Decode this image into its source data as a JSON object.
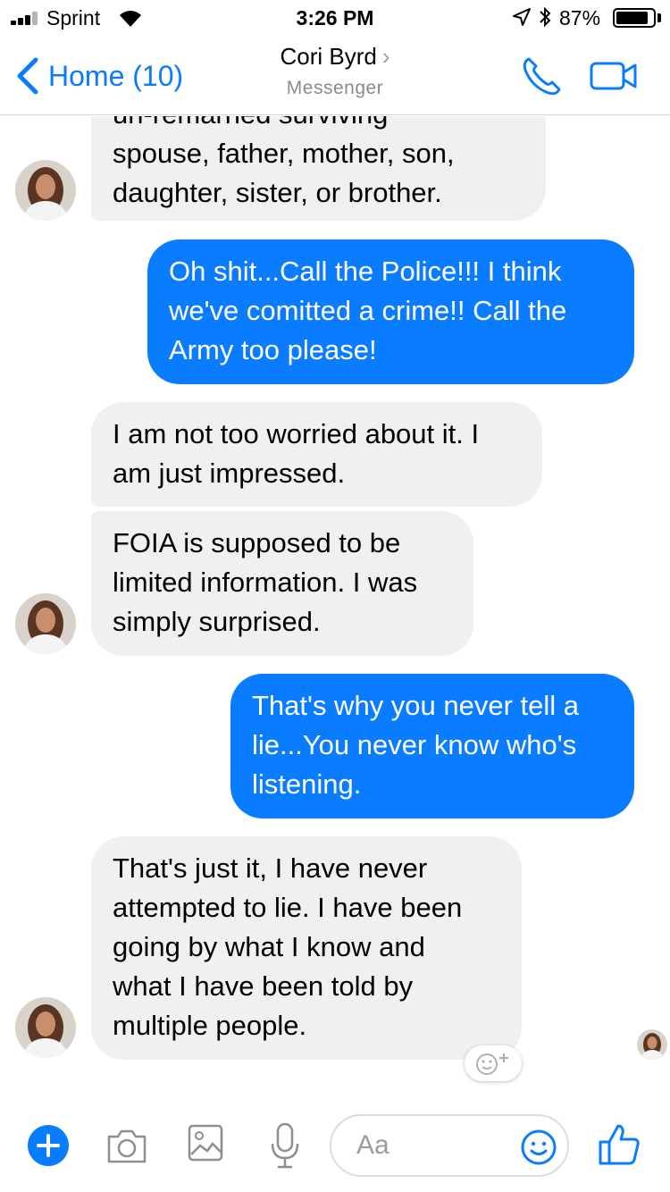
{
  "status_bar": {
    "carrier": "Sprint",
    "time": "3:26 PM",
    "battery_percent": "87%",
    "battery_level": 0.87,
    "signal_bars_filled": 3
  },
  "header": {
    "back_label": "Home (10)",
    "contact_name": "Cori Byrd",
    "subtitle": "Messenger",
    "call_icon": "phone-icon",
    "video_icon": "video-camera-icon"
  },
  "messages": [
    {
      "direction": "in",
      "lines": [
        "un-remarried surviving",
        "spouse, father, mother, son,",
        "daughter, sister, or brother."
      ]
    },
    {
      "direction": "out",
      "lines": [
        "Oh shit...Call the Police!!! I think",
        "we've comitted a crime!! Call the",
        "Army too please!"
      ]
    },
    {
      "direction": "in",
      "lines": [
        "I am not too worried about it. I",
        "am just impressed."
      ]
    },
    {
      "direction": "in",
      "lines": [
        "FOIA is supposed to be",
        "limited information. I was",
        "simply surprised."
      ]
    },
    {
      "direction": "out",
      "lines": [
        "That's why you never tell a",
        "lie...You never know who's",
        "listening."
      ]
    },
    {
      "direction": "in",
      "lines": [
        "That's just it, I have never",
        "attempted to lie. I have been",
        "going by what I know and",
        "what I have been told by",
        "multiple people."
      ]
    }
  ],
  "composer": {
    "placeholder": "Aa",
    "icons": [
      "plus-icon",
      "camera-icon",
      "image-icon",
      "microphone-icon",
      "emoji-icon",
      "thumbs-up-icon"
    ]
  },
  "colors": {
    "accent": "#0a7cff",
    "incoming_bubble": "#f1f0f0",
    "outgoing_text": "#ffffff"
  }
}
